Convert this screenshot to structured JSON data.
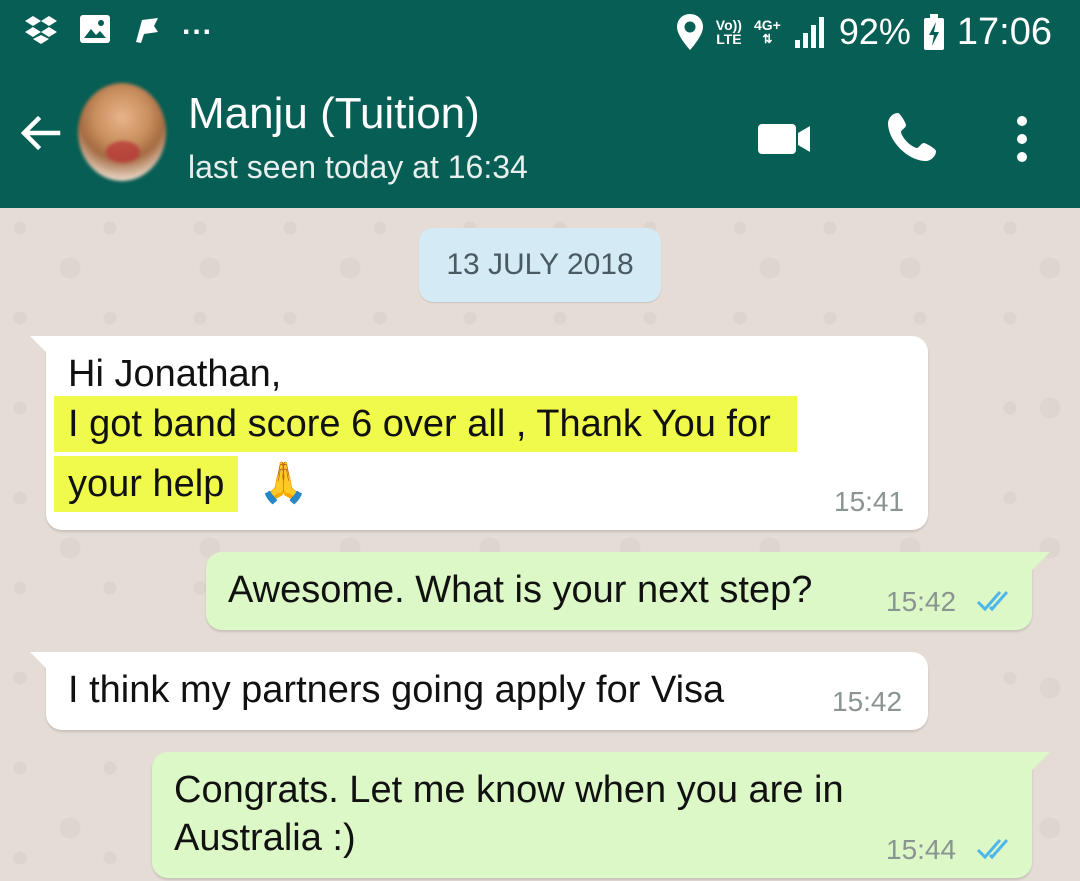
{
  "status_bar": {
    "volte_line1": "Vo))",
    "volte_line2": "LTE",
    "network": "4G+",
    "battery": "92%",
    "time": "17:06",
    "icons": [
      "dropbox-icon",
      "image-icon",
      "flag-icon",
      "more-notifications-icon",
      "location-icon",
      "signal-icon",
      "battery-charging-icon"
    ],
    "more_notifications": "..."
  },
  "header": {
    "contact_name": "Manju (Tuition)",
    "last_seen": "last seen today at 16:34",
    "icons": [
      "back-arrow-icon",
      "video-call-icon",
      "voice-call-icon",
      "more-vert-icon"
    ]
  },
  "chat": {
    "date_chip": "13 JULY 2018",
    "messages": [
      {
        "direction": "incoming",
        "lines": [
          "Hi Jonathan,",
          "I got band score 6 over all , Thank You for",
          "your help"
        ],
        "emoji": "🙏",
        "time": "15:41"
      },
      {
        "direction": "outgoing",
        "lines": [
          "Awesome. What is your next step?"
        ],
        "time": "15:42",
        "status": "read"
      },
      {
        "direction": "incoming",
        "lines": [
          "I think my partners going apply for Visa"
        ],
        "time": "15:42"
      },
      {
        "direction": "outgoing",
        "lines": [
          "Congrats. Let me know when you are in",
          "Australia :)"
        ],
        "time": "15:44",
        "status": "read"
      }
    ]
  },
  "colors": {
    "header_bg": "#075e54",
    "incoming_bubble": "#ffffff",
    "outgoing_bubble": "#dcf8c6",
    "date_chip_bg": "#d4eaf4",
    "highlight": "#f0fa4b",
    "read_ticks": "#4fb6ec",
    "chat_bg": "#e5ddd5"
  }
}
